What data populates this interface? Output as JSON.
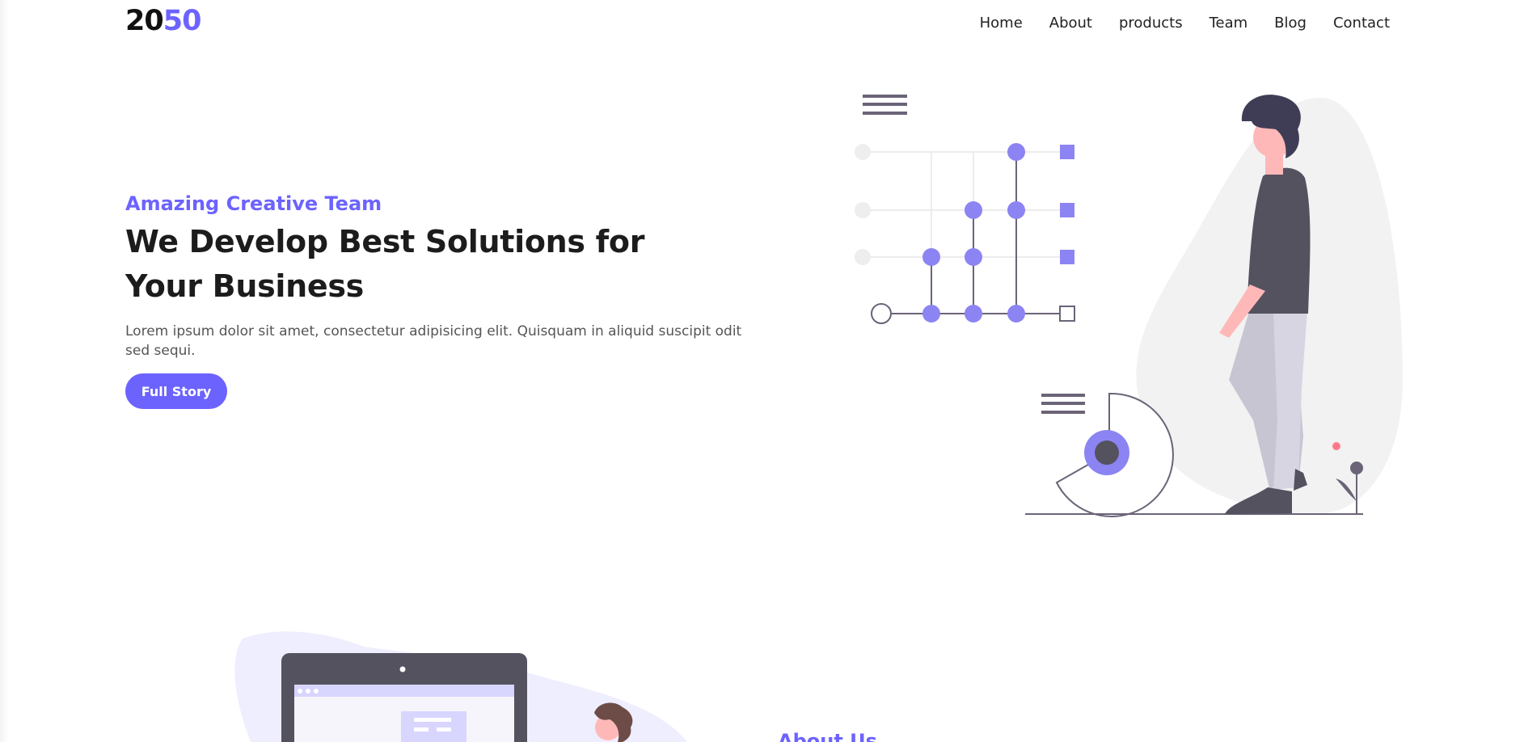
{
  "brand": {
    "logo_part1": "20",
    "logo_part2": "50",
    "accent": "#6c63ff"
  },
  "nav": {
    "items": [
      "Home",
      "About",
      "products",
      "Team",
      "Blog",
      "Contact"
    ]
  },
  "hero": {
    "eyebrow": "Amazing Creative Team",
    "headline": "We Develop Best Solutions for Your Business",
    "lead": "Lorem ipsum dolor sit amet, consectetur adipisicing elit. Quisquam in aliquid suscipit odit sed sequi.",
    "cta_label": "Full Story"
  },
  "about": {
    "title": "About Us"
  }
}
